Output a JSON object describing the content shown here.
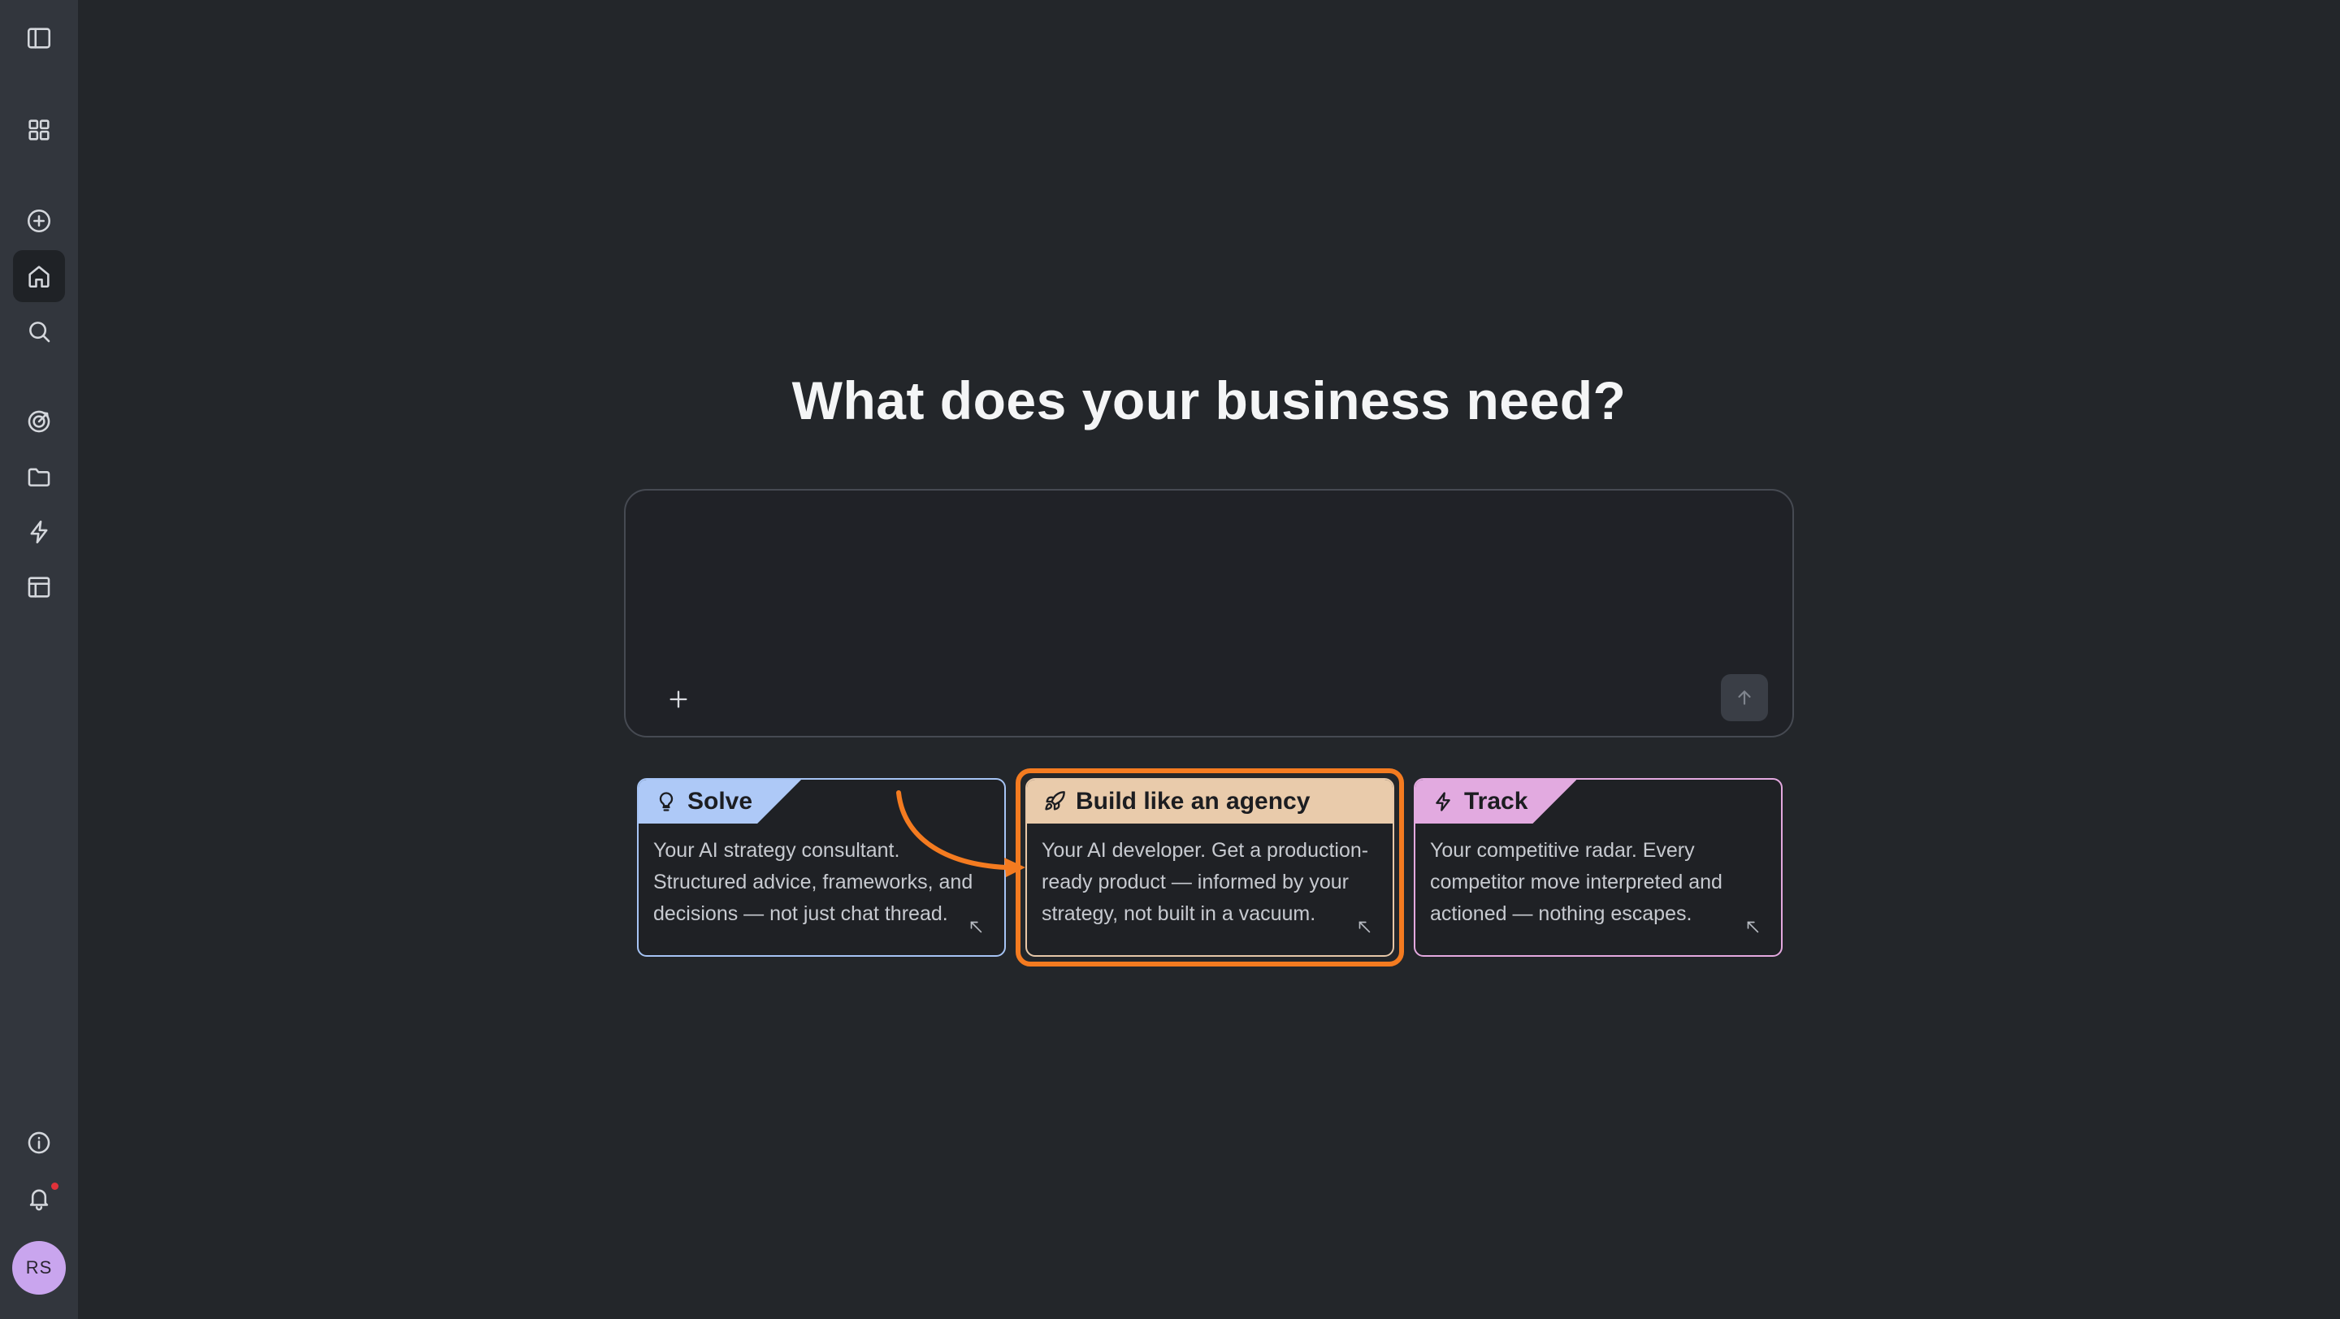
{
  "sidebar": {
    "items": [
      {
        "name": "toggle-sidebar",
        "icon": "sidebar-toggle-icon"
      },
      {
        "name": "apps",
        "icon": "grid-icon"
      },
      {
        "name": "new",
        "icon": "plus-circle-icon"
      },
      {
        "name": "home",
        "icon": "home-icon",
        "active": true
      },
      {
        "name": "search",
        "icon": "search-icon"
      },
      {
        "name": "goals",
        "icon": "target-icon"
      },
      {
        "name": "files",
        "icon": "folder-icon"
      },
      {
        "name": "automations",
        "icon": "lightning-icon"
      },
      {
        "name": "layout",
        "icon": "layout-icon"
      },
      {
        "name": "info",
        "icon": "info-icon"
      },
      {
        "name": "notifications",
        "icon": "bell-icon"
      }
    ],
    "avatar_initials": "RS"
  },
  "main": {
    "title": "What does your business need?",
    "composer": {
      "placeholder": "",
      "value": ""
    },
    "cards": [
      {
        "id": "solve",
        "label": "Solve",
        "icon": "lightbulb-icon",
        "description": "Your AI strategy consultant. Structured advice, frameworks, and decisions — not just chat thread.",
        "color": "#aec9f7"
      },
      {
        "id": "build",
        "label": "Build like an agency",
        "icon": "rocket-icon",
        "description": "Your AI developer. Get a production-ready product — informed by your strategy, not built in a vacuum.",
        "color": "#e9cbab",
        "highlighted": true
      },
      {
        "id": "track",
        "label": "Track",
        "icon": "lightning-icon",
        "description": "Your competitive radar. Every competitor move interpreted and actioned — nothing escapes.",
        "color": "#e2aae0"
      }
    ]
  },
  "colors": {
    "background": "#23262a",
    "sidebar": "#32363d",
    "highlight": "#f47b20",
    "avatar": "#c9a5ee"
  }
}
